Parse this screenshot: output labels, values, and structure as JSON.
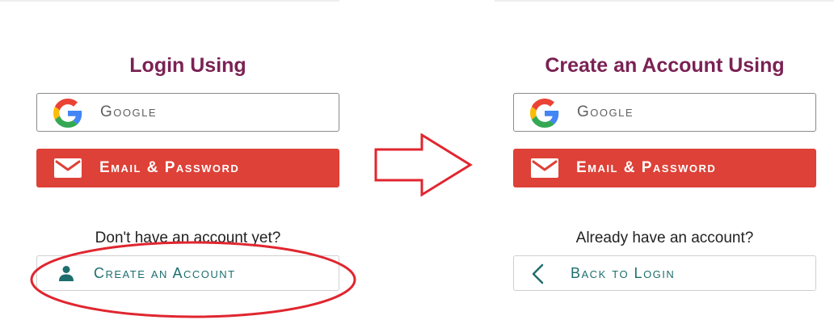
{
  "left_panel": {
    "title": "Login Using",
    "google_label": "Google",
    "email_label": "Email & Password",
    "prompt": "Don't have an account yet?",
    "secondary_label": "Create an Account",
    "secondary_icon": "person-icon"
  },
  "right_panel": {
    "title": "Create an Account Using",
    "google_label": "Google",
    "email_label": "Email & Password",
    "prompt": "Already have an account?",
    "secondary_label": "Back to Login",
    "secondary_icon": "chevron-left-icon"
  },
  "colors": {
    "title": "#7a2254",
    "email_button": "#de4137",
    "secondary_text": "#1e6e6e",
    "annotation": "#e0262f"
  },
  "annotations": {
    "arrow_icon": "right-arrow-icon",
    "highlight_icon": "ellipse-highlight-icon"
  }
}
